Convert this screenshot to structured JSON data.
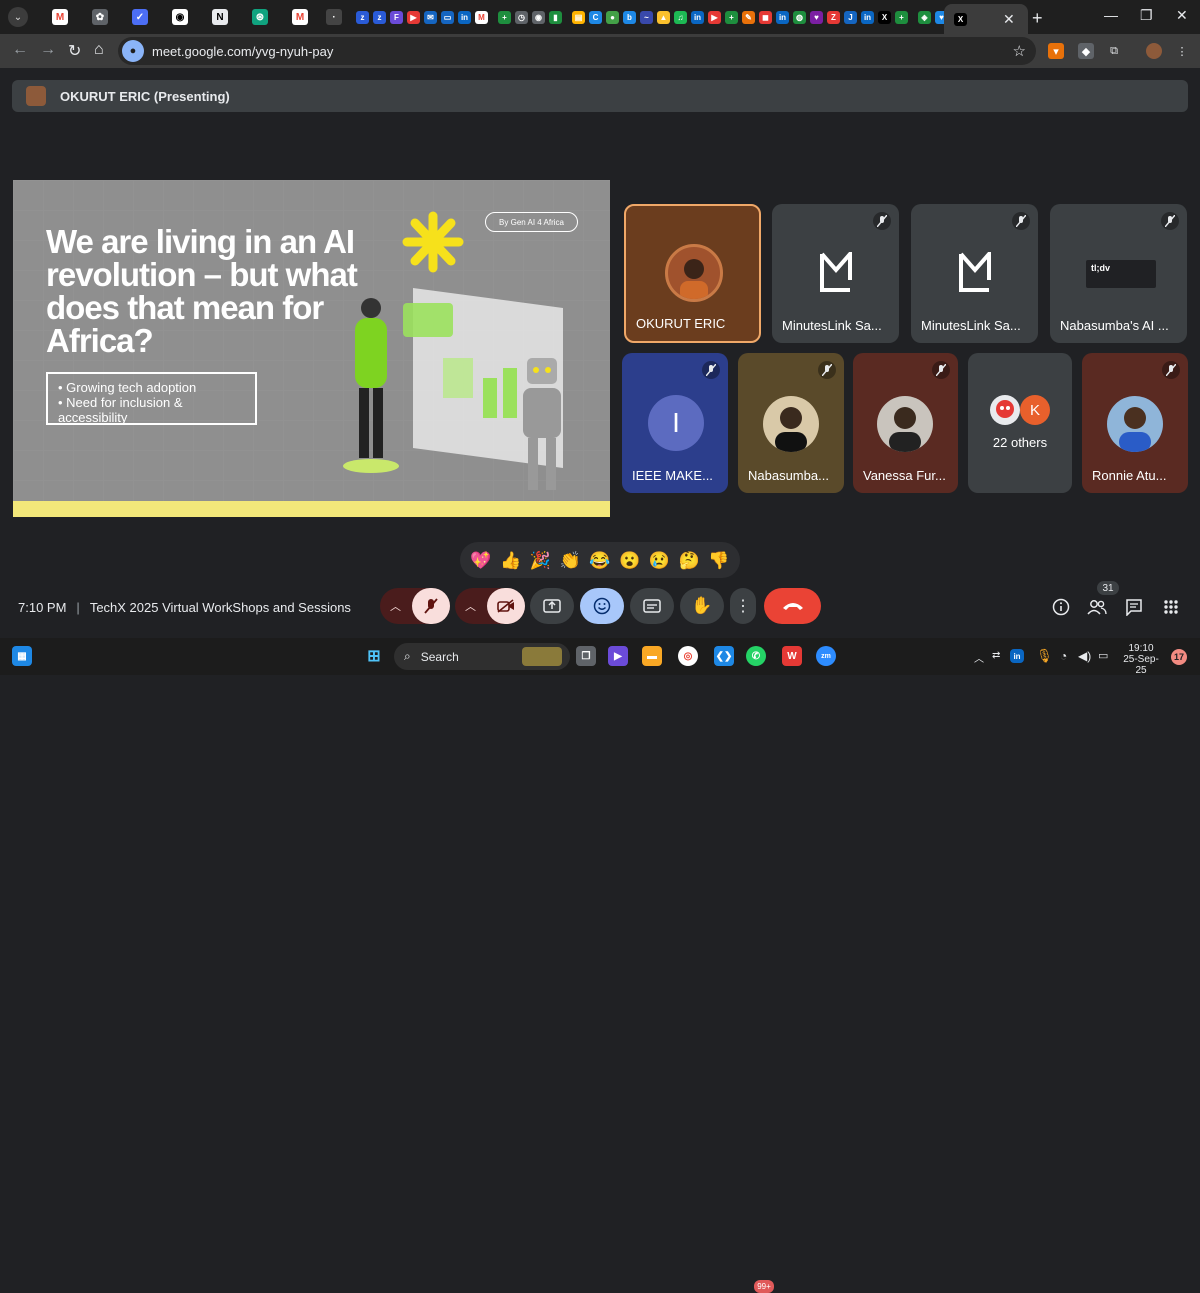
{
  "browser": {
    "url": "meet.google.com/yvg-nyuh-pay",
    "active_tab_close": "✕",
    "new_tab": "+",
    "tab_menu": "⌄"
  },
  "meet": {
    "presenter_label": "OKURUT ERIC (Presenting)",
    "slide": {
      "badge": "By Gen AI 4 Africa",
      "title": "We are living in an AI revolution – but what does that mean for Africa?",
      "bullets": [
        "Growing tech adoption",
        "Need for inclusion & accessibility"
      ]
    },
    "tiles_row1": [
      {
        "name": "OKURUT ERIC",
        "icon": "camera-avatar"
      },
      {
        "name": "MinutesLink Sa...",
        "icon": "minuteslink-logo"
      },
      {
        "name": "MinutesLink Sa...",
        "icon": "minuteslink-logo"
      },
      {
        "name": "Nabasumba's AI ...",
        "icon": "tldv-logo"
      }
    ],
    "tldv_logo_text": "tl;dv",
    "tiles_row2": [
      {
        "name": "IEEE MAKE...",
        "initial": "I"
      },
      {
        "name": "Nabasumba...",
        "initial": ""
      },
      {
        "name": "Vanessa Fur...",
        "initial": ""
      },
      {
        "name": "22 others",
        "initial": "K"
      },
      {
        "name": "Ronnie Atu...",
        "initial": ""
      }
    ],
    "reactions": [
      "💖",
      "👍",
      "🎉",
      "👏",
      "😂",
      "😮",
      "😢",
      "🤔",
      "👎"
    ],
    "meeting_time": "7:10 PM",
    "meeting_title": "TechX 2025 Virtual WorkShops and Sessions",
    "participant_count": "31",
    "colors": {
      "accent": "#8ab4f8",
      "mic_off": "#f9dedc",
      "hangup": "#ea4335"
    }
  },
  "taskbar": {
    "search_label": "Search",
    "whatsapp_badge": "99+",
    "time": "19:10",
    "date": "25-Sep-25",
    "notifications": "17"
  }
}
